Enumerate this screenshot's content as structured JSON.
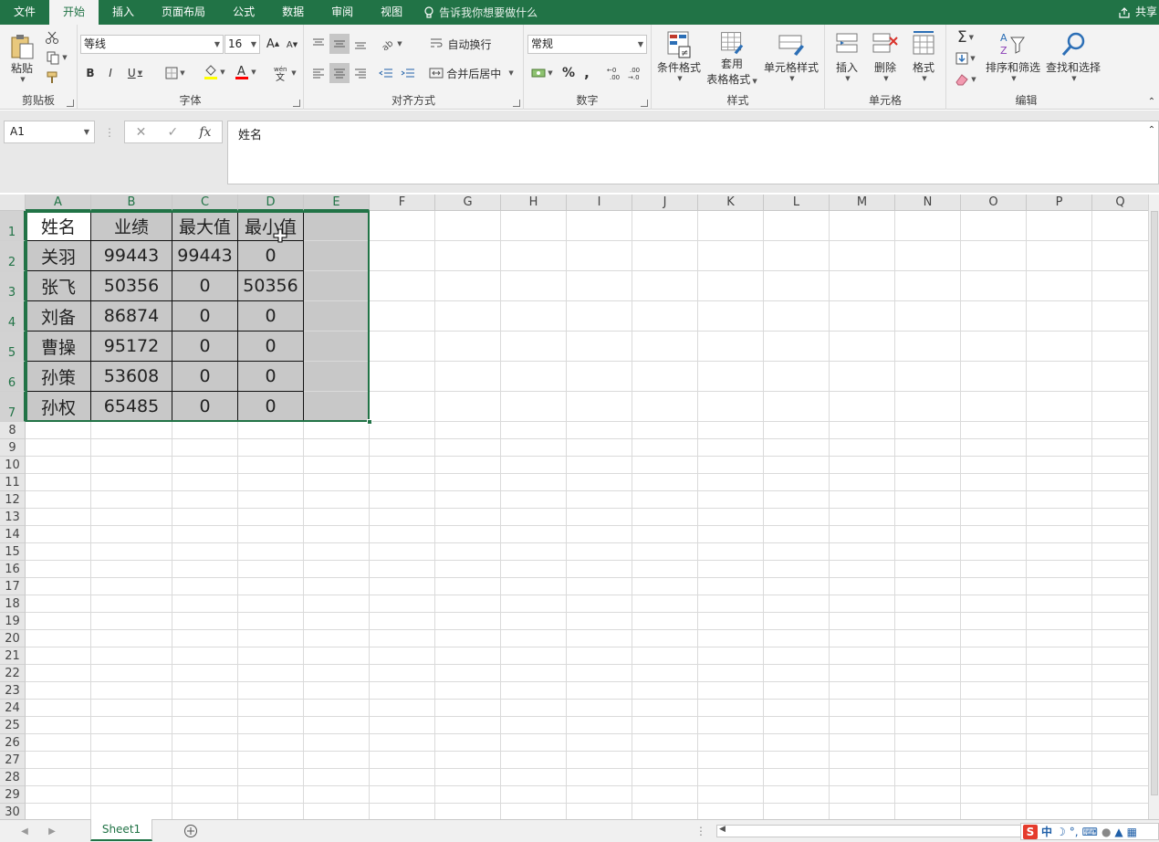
{
  "menu": {
    "tabs": [
      "文件",
      "开始",
      "插入",
      "页面布局",
      "公式",
      "数据",
      "审阅",
      "视图"
    ],
    "active_index": 1,
    "tell_me": "告诉我你想要做什么",
    "share": "共享"
  },
  "ribbon": {
    "clipboard": {
      "paste": "粘贴",
      "label": "剪贴板"
    },
    "font": {
      "name": "等线",
      "size": "16",
      "label": "字体",
      "bold": "B",
      "italic": "I",
      "underline": "U",
      "grow": "A",
      "shrink": "A"
    },
    "alignment": {
      "wrap": "自动换行",
      "merge": "合并后居中",
      "label": "对齐方式"
    },
    "number": {
      "format": "常规",
      "percent": "%",
      "comma": ",",
      "label": "数字"
    },
    "styles": {
      "conditional": "条件格式",
      "table_line1": "套用",
      "table_line2": "表格格式",
      "cell_styles": "单元格样式",
      "label": "样式"
    },
    "cells": {
      "insert": "插入",
      "delete": "删除",
      "format": "格式",
      "label": "单元格"
    },
    "editing": {
      "sort": "排序和筛选",
      "find": "查找和选择",
      "label": "编辑"
    }
  },
  "formula_bar": {
    "name_box": "A1",
    "content": "姓名",
    "fx": "fx"
  },
  "columns": [
    "A",
    "B",
    "C",
    "D",
    "E",
    "F",
    "G",
    "H",
    "I",
    "J",
    "K",
    "L",
    "M",
    "N",
    "O",
    "P",
    "Q"
  ],
  "rows": [
    "1",
    "2",
    "3",
    "4",
    "5",
    "6",
    "7",
    "8",
    "9",
    "10",
    "11",
    "12",
    "13",
    "14",
    "15",
    "16",
    "17",
    "18",
    "19",
    "20",
    "21",
    "22",
    "23",
    "24",
    "25",
    "26",
    "27",
    "28",
    "29",
    "30"
  ],
  "table": {
    "headers": [
      "姓名",
      "业绩",
      "最大值",
      "最小值"
    ],
    "data": [
      [
        "关羽",
        "99443",
        "99443",
        "0"
      ],
      [
        "张飞",
        "50356",
        "0",
        "50356"
      ],
      [
        "刘备",
        "86874",
        "0",
        "0"
      ],
      [
        "曹操",
        "95172",
        "0",
        "0"
      ],
      [
        "孙策",
        "53608",
        "0",
        "0"
      ],
      [
        "孙权",
        "65485",
        "0",
        "0"
      ]
    ]
  },
  "sheets": [
    "Sheet1"
  ],
  "ime": {
    "logo": "S",
    "mode": "中"
  },
  "colors": {
    "accent": "#217346",
    "selection": "#c8c8c8"
  }
}
